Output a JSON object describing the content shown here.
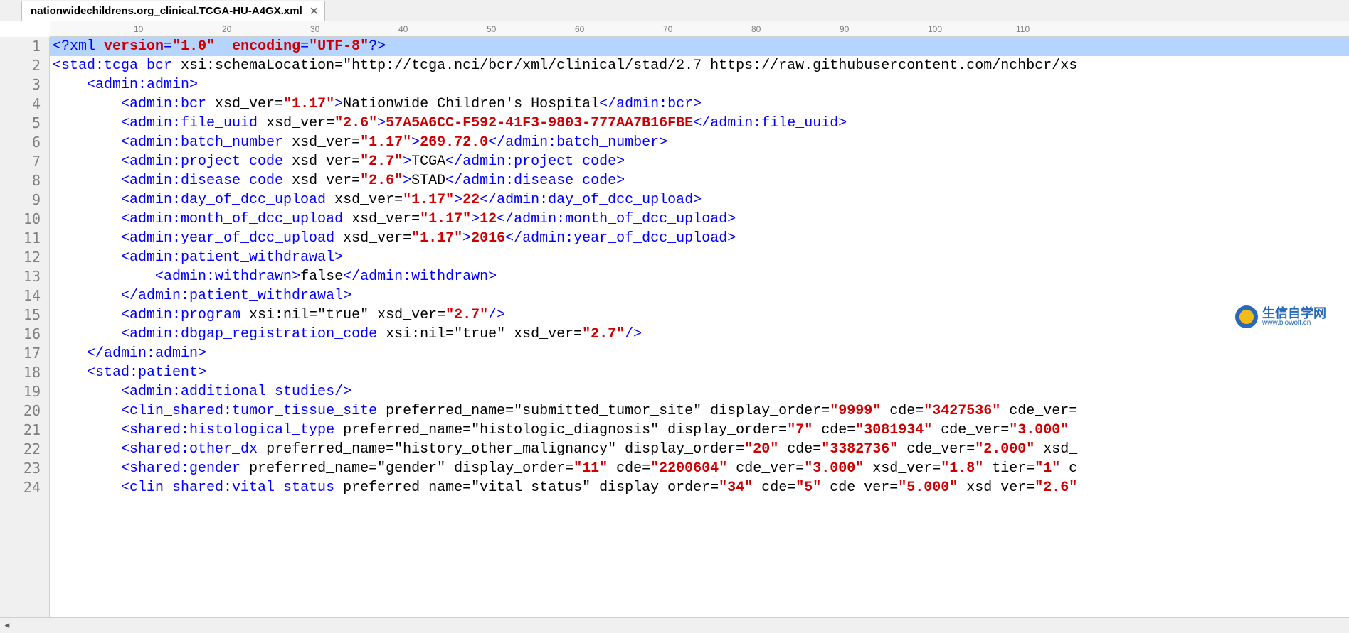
{
  "tab": {
    "title": "nationwidechildrens.org_clinical.TCGA-HU-A4GX.xml"
  },
  "ruler_marks": [
    10,
    20,
    30,
    40,
    50,
    60,
    70,
    80,
    90,
    100,
    110
  ],
  "watermark": {
    "cn": "生信自学网",
    "en": "www.biowolf.cn"
  },
  "code_lines": [
    {
      "n": 1,
      "hl": true,
      "segs": [
        {
          "c": "t-decl",
          "t": "<?"
        },
        {
          "c": "t-tag",
          "t": "xml "
        },
        {
          "c": "t-declkw",
          "t": "version"
        },
        {
          "c": "t-tag",
          "t": "="
        },
        {
          "c": "t-declkw",
          "t": "\"1.0\""
        },
        {
          "c": "t-tag",
          "t": "  "
        },
        {
          "c": "t-declkw",
          "t": "encoding"
        },
        {
          "c": "t-tag",
          "t": "="
        },
        {
          "c": "t-declkw",
          "t": "\"UTF-8\""
        },
        {
          "c": "t-decl",
          "t": "?>"
        }
      ]
    },
    {
      "n": 2,
      "segs": [
        {
          "c": "t-tag",
          "t": "<stad:tcga_bcr "
        },
        {
          "c": "t-attr",
          "t": "xsi:schemaLocation="
        },
        {
          "c": "t-attr",
          "t": "\"http://tcga.nci/bcr/xml/clinical/stad/2.7 https://raw.githubusercontent.com/nchbcr/xs"
        }
      ]
    },
    {
      "n": 3,
      "indent": 1,
      "segs": [
        {
          "c": "t-tag",
          "t": "<admin:admin>"
        }
      ]
    },
    {
      "n": 4,
      "indent": 2,
      "segs": [
        {
          "c": "t-tag",
          "t": "<admin:bcr "
        },
        {
          "c": "t-attr",
          "t": "xsd_ver="
        },
        {
          "c": "t-val",
          "t": "\"1.17\""
        },
        {
          "c": "t-tag",
          "t": ">"
        },
        {
          "c": "t-txt",
          "t": "Nationwide Children's Hospital"
        },
        {
          "c": "t-tag",
          "t": "</admin:bcr>"
        }
      ]
    },
    {
      "n": 5,
      "indent": 2,
      "segs": [
        {
          "c": "t-tag",
          "t": "<admin:file_uuid "
        },
        {
          "c": "t-attr",
          "t": "xsd_ver="
        },
        {
          "c": "t-val",
          "t": "\"2.6\""
        },
        {
          "c": "t-tag",
          "t": ">"
        },
        {
          "c": "t-val",
          "t": "57A5A6CC-F592-41F3-9803-777AA7B16FBE"
        },
        {
          "c": "t-tag",
          "t": "</admin:file_uuid>"
        }
      ]
    },
    {
      "n": 6,
      "indent": 2,
      "segs": [
        {
          "c": "t-tag",
          "t": "<admin:batch_number "
        },
        {
          "c": "t-attr",
          "t": "xsd_ver="
        },
        {
          "c": "t-val",
          "t": "\"1.17\""
        },
        {
          "c": "t-tag",
          "t": ">"
        },
        {
          "c": "t-val",
          "t": "269.72.0"
        },
        {
          "c": "t-tag",
          "t": "</admin:batch_number>"
        }
      ]
    },
    {
      "n": 7,
      "indent": 2,
      "segs": [
        {
          "c": "t-tag",
          "t": "<admin:project_code "
        },
        {
          "c": "t-attr",
          "t": "xsd_ver="
        },
        {
          "c": "t-val",
          "t": "\"2.7\""
        },
        {
          "c": "t-tag",
          "t": ">"
        },
        {
          "c": "t-txt",
          "t": "TCGA"
        },
        {
          "c": "t-tag",
          "t": "</admin:project_code>"
        }
      ]
    },
    {
      "n": 8,
      "indent": 2,
      "segs": [
        {
          "c": "t-tag",
          "t": "<admin:disease_code "
        },
        {
          "c": "t-attr",
          "t": "xsd_ver="
        },
        {
          "c": "t-val",
          "t": "\"2.6\""
        },
        {
          "c": "t-tag",
          "t": ">"
        },
        {
          "c": "t-txt",
          "t": "STAD"
        },
        {
          "c": "t-tag",
          "t": "</admin:disease_code>"
        }
      ]
    },
    {
      "n": 9,
      "indent": 2,
      "segs": [
        {
          "c": "t-tag",
          "t": "<admin:day_of_dcc_upload "
        },
        {
          "c": "t-attr",
          "t": "xsd_ver="
        },
        {
          "c": "t-val",
          "t": "\"1.17\""
        },
        {
          "c": "t-tag",
          "t": ">"
        },
        {
          "c": "t-val",
          "t": "22"
        },
        {
          "c": "t-tag",
          "t": "</admin:day_of_dcc_upload>"
        }
      ]
    },
    {
      "n": 10,
      "indent": 2,
      "segs": [
        {
          "c": "t-tag",
          "t": "<admin:month_of_dcc_upload "
        },
        {
          "c": "t-attr",
          "t": "xsd_ver="
        },
        {
          "c": "t-val",
          "t": "\"1.17\""
        },
        {
          "c": "t-tag",
          "t": ">"
        },
        {
          "c": "t-val",
          "t": "12"
        },
        {
          "c": "t-tag",
          "t": "</admin:month_of_dcc_upload>"
        }
      ]
    },
    {
      "n": 11,
      "indent": 2,
      "segs": [
        {
          "c": "t-tag",
          "t": "<admin:year_of_dcc_upload "
        },
        {
          "c": "t-attr",
          "t": "xsd_ver="
        },
        {
          "c": "t-val",
          "t": "\"1.17\""
        },
        {
          "c": "t-tag",
          "t": ">"
        },
        {
          "c": "t-val",
          "t": "2016"
        },
        {
          "c": "t-tag",
          "t": "</admin:year_of_dcc_upload>"
        }
      ]
    },
    {
      "n": 12,
      "indent": 2,
      "segs": [
        {
          "c": "t-tag",
          "t": "<admin:patient_withdrawal>"
        }
      ]
    },
    {
      "n": 13,
      "indent": 3,
      "segs": [
        {
          "c": "t-tag",
          "t": "<admin:withdrawn>"
        },
        {
          "c": "t-txt",
          "t": "false"
        },
        {
          "c": "t-tag",
          "t": "</admin:withdrawn>"
        }
      ]
    },
    {
      "n": 14,
      "indent": 2,
      "segs": [
        {
          "c": "t-tag",
          "t": "</admin:patient_withdrawal>"
        }
      ]
    },
    {
      "n": 15,
      "indent": 2,
      "segs": [
        {
          "c": "t-tag",
          "t": "<admin:program "
        },
        {
          "c": "t-attr",
          "t": "xsi:nil="
        },
        {
          "c": "t-attr",
          "t": "\"true\" "
        },
        {
          "c": "t-attr",
          "t": "xsd_ver="
        },
        {
          "c": "t-val",
          "t": "\"2.7\""
        },
        {
          "c": "t-tag",
          "t": "/>"
        }
      ]
    },
    {
      "n": 16,
      "indent": 2,
      "segs": [
        {
          "c": "t-tag",
          "t": "<admin:dbgap_registration_code "
        },
        {
          "c": "t-attr",
          "t": "xsi:nil="
        },
        {
          "c": "t-attr",
          "t": "\"true\" "
        },
        {
          "c": "t-attr",
          "t": "xsd_ver="
        },
        {
          "c": "t-val",
          "t": "\"2.7\""
        },
        {
          "c": "t-tag",
          "t": "/>"
        }
      ]
    },
    {
      "n": 17,
      "indent": 1,
      "segs": [
        {
          "c": "t-tag",
          "t": "</admin:admin>"
        }
      ]
    },
    {
      "n": 18,
      "indent": 1,
      "segs": [
        {
          "c": "t-tag",
          "t": "<stad:patient>"
        }
      ]
    },
    {
      "n": 19,
      "indent": 2,
      "segs": [
        {
          "c": "t-tag",
          "t": "<admin:additional_studies/>"
        }
      ]
    },
    {
      "n": 20,
      "indent": 2,
      "segs": [
        {
          "c": "t-tag",
          "t": "<clin_shared:tumor_tissue_site "
        },
        {
          "c": "t-attr",
          "t": "preferred_name="
        },
        {
          "c": "t-attr",
          "t": "\"submitted_tumor_site\" "
        },
        {
          "c": "t-attr",
          "t": "display_order="
        },
        {
          "c": "t-val",
          "t": "\"9999\" "
        },
        {
          "c": "t-attr",
          "t": "cde="
        },
        {
          "c": "t-val",
          "t": "\"3427536\" "
        },
        {
          "c": "t-attr",
          "t": "cde_ver="
        }
      ]
    },
    {
      "n": 21,
      "indent": 2,
      "segs": [
        {
          "c": "t-tag",
          "t": "<shared:histological_type "
        },
        {
          "c": "t-attr",
          "t": "preferred_name="
        },
        {
          "c": "t-attr",
          "t": "\"histologic_diagnosis\" "
        },
        {
          "c": "t-attr",
          "t": "display_order="
        },
        {
          "c": "t-val",
          "t": "\"7\" "
        },
        {
          "c": "t-attr",
          "t": "cde="
        },
        {
          "c": "t-val",
          "t": "\"3081934\" "
        },
        {
          "c": "t-attr",
          "t": "cde_ver="
        },
        {
          "c": "t-val",
          "t": "\"3.000\" "
        }
      ]
    },
    {
      "n": 22,
      "indent": 2,
      "segs": [
        {
          "c": "t-tag",
          "t": "<shared:other_dx "
        },
        {
          "c": "t-attr",
          "t": "preferred_name="
        },
        {
          "c": "t-attr",
          "t": "\"history_other_malignancy\" "
        },
        {
          "c": "t-attr",
          "t": "display_order="
        },
        {
          "c": "t-val",
          "t": "\"20\" "
        },
        {
          "c": "t-attr",
          "t": "cde="
        },
        {
          "c": "t-val",
          "t": "\"3382736\" "
        },
        {
          "c": "t-attr",
          "t": "cde_ver="
        },
        {
          "c": "t-val",
          "t": "\"2.000\" "
        },
        {
          "c": "t-attr",
          "t": "xsd_"
        }
      ]
    },
    {
      "n": 23,
      "indent": 2,
      "segs": [
        {
          "c": "t-tag",
          "t": "<shared:gender "
        },
        {
          "c": "t-attr",
          "t": "preferred_name="
        },
        {
          "c": "t-attr",
          "t": "\"gender\" "
        },
        {
          "c": "t-attr",
          "t": "display_order="
        },
        {
          "c": "t-val",
          "t": "\"11\" "
        },
        {
          "c": "t-attr",
          "t": "cde="
        },
        {
          "c": "t-val",
          "t": "\"2200604\" "
        },
        {
          "c": "t-attr",
          "t": "cde_ver="
        },
        {
          "c": "t-val",
          "t": "\"3.000\" "
        },
        {
          "c": "t-attr",
          "t": "xsd_ver="
        },
        {
          "c": "t-val",
          "t": "\"1.8\" "
        },
        {
          "c": "t-attr",
          "t": "tier="
        },
        {
          "c": "t-val",
          "t": "\"1\" "
        },
        {
          "c": "t-attr",
          "t": "c"
        }
      ]
    },
    {
      "n": 24,
      "indent": 2,
      "segs": [
        {
          "c": "t-tag",
          "t": "<clin_shared:vital_status "
        },
        {
          "c": "t-attr",
          "t": "preferred_name="
        },
        {
          "c": "t-attr",
          "t": "\"vital_status\" "
        },
        {
          "c": "t-attr",
          "t": "display_order="
        },
        {
          "c": "t-val",
          "t": "\"34\" "
        },
        {
          "c": "t-attr",
          "t": "cde="
        },
        {
          "c": "t-val",
          "t": "\"5\" "
        },
        {
          "c": "t-attr",
          "t": "cde_ver="
        },
        {
          "c": "t-val",
          "t": "\"5.000\" "
        },
        {
          "c": "t-attr",
          "t": "xsd_ver="
        },
        {
          "c": "t-val",
          "t": "\"2.6\" "
        }
      ]
    }
  ]
}
